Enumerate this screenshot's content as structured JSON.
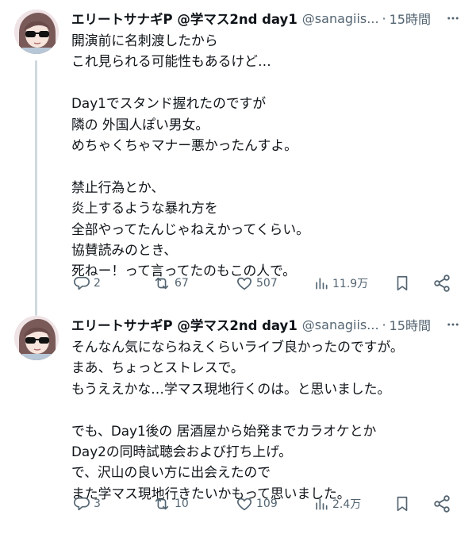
{
  "tweets": [
    {
      "author": {
        "display_name": "エリートサナギP @学マス2nd day1",
        "handle": "@sanagiis...",
        "time": "15時間"
      },
      "lines": [
        "開演前に名刺渡したから",
        "これ見られる可能性もあるけど…",
        "",
        "Day1でスタンド握れたのですが",
        "隣の 外国人ぽい男女。",
        "めちゃくちゃマナー悪かったんすよ。",
        "",
        "禁止行為とか、",
        "炎上するような暴れ方を",
        "全部やってたんじゃねえかってくらい。",
        "協賛読みのとき、",
        "死ねー！って言ってたのもこの人で。"
      ],
      "stats": {
        "replies": "2",
        "retweets": "67",
        "likes": "507",
        "views": "11.9万"
      }
    },
    {
      "author": {
        "display_name": "エリートサナギP @学マス2nd day1",
        "handle": "@sanagiis...",
        "time": "15時間"
      },
      "lines": [
        "そんなん気にならねえくらいライブ良かったのですが。",
        "まあ、ちょっとストレスで。",
        "もうええかな…学マス現地行くのは。と思いました。",
        "",
        "でも、Day1後の 居酒屋から始発までカラオケとか",
        "Day2の同時試聴会および打ち上げ。",
        "で、沢山の良い方に出会えたので",
        "また学マス現地行きたいかもって思いました。"
      ],
      "stats": {
        "replies": "3",
        "retweets": "10",
        "likes": "109",
        "views": "2.4万"
      }
    }
  ],
  "icons": {
    "more": "more-horizontal-icon",
    "reply": "reply-bubble-icon",
    "retweet": "retweet-arrows-icon",
    "like": "heart-icon",
    "views": "bar-chart-icon",
    "bookmark": "bookmark-icon",
    "share": "share-nodes-icon"
  },
  "colors": {
    "text": "#0f1419",
    "secondary": "#536471",
    "thread_line": "#cfd9de",
    "background": "#ffffff"
  }
}
